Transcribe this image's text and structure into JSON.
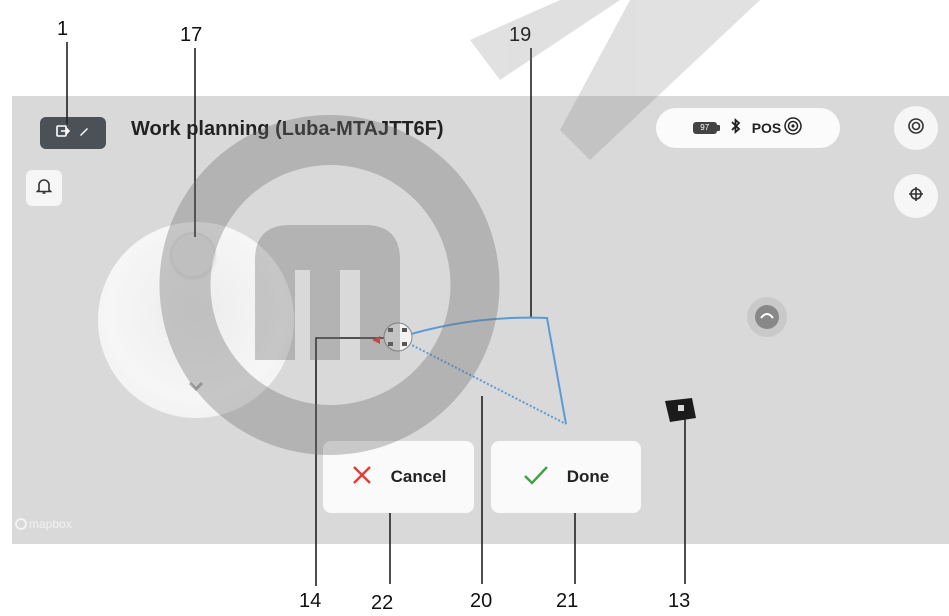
{
  "callouts": {
    "c1": "1",
    "c17": "17",
    "c19": "19",
    "c14": "14",
    "c22": "22",
    "c20": "20",
    "c21": "21",
    "c13": "13"
  },
  "header": {
    "title": "Work planning (Luba-MTAJTT6F)"
  },
  "status": {
    "battery": "97",
    "pos_label": "POS"
  },
  "actions": {
    "cancel_label": "Cancel",
    "done_label": "Done"
  },
  "map": {
    "attribution": "mapbox"
  },
  "icons": {
    "mode": "map-pin-edit-icon",
    "bell": "bell-icon",
    "settings": "target-icon",
    "locate": "crosshair-icon",
    "bluetooth": "bluetooth-icon",
    "rtk": "antenna-icon",
    "robot": "mower-icon",
    "station": "charging-station-icon",
    "cancel": "close-icon",
    "done": "check-icon"
  },
  "colors": {
    "cancel_x": "#e53935",
    "done_check": "#43a047",
    "path_line": "#5b9bd5"
  }
}
